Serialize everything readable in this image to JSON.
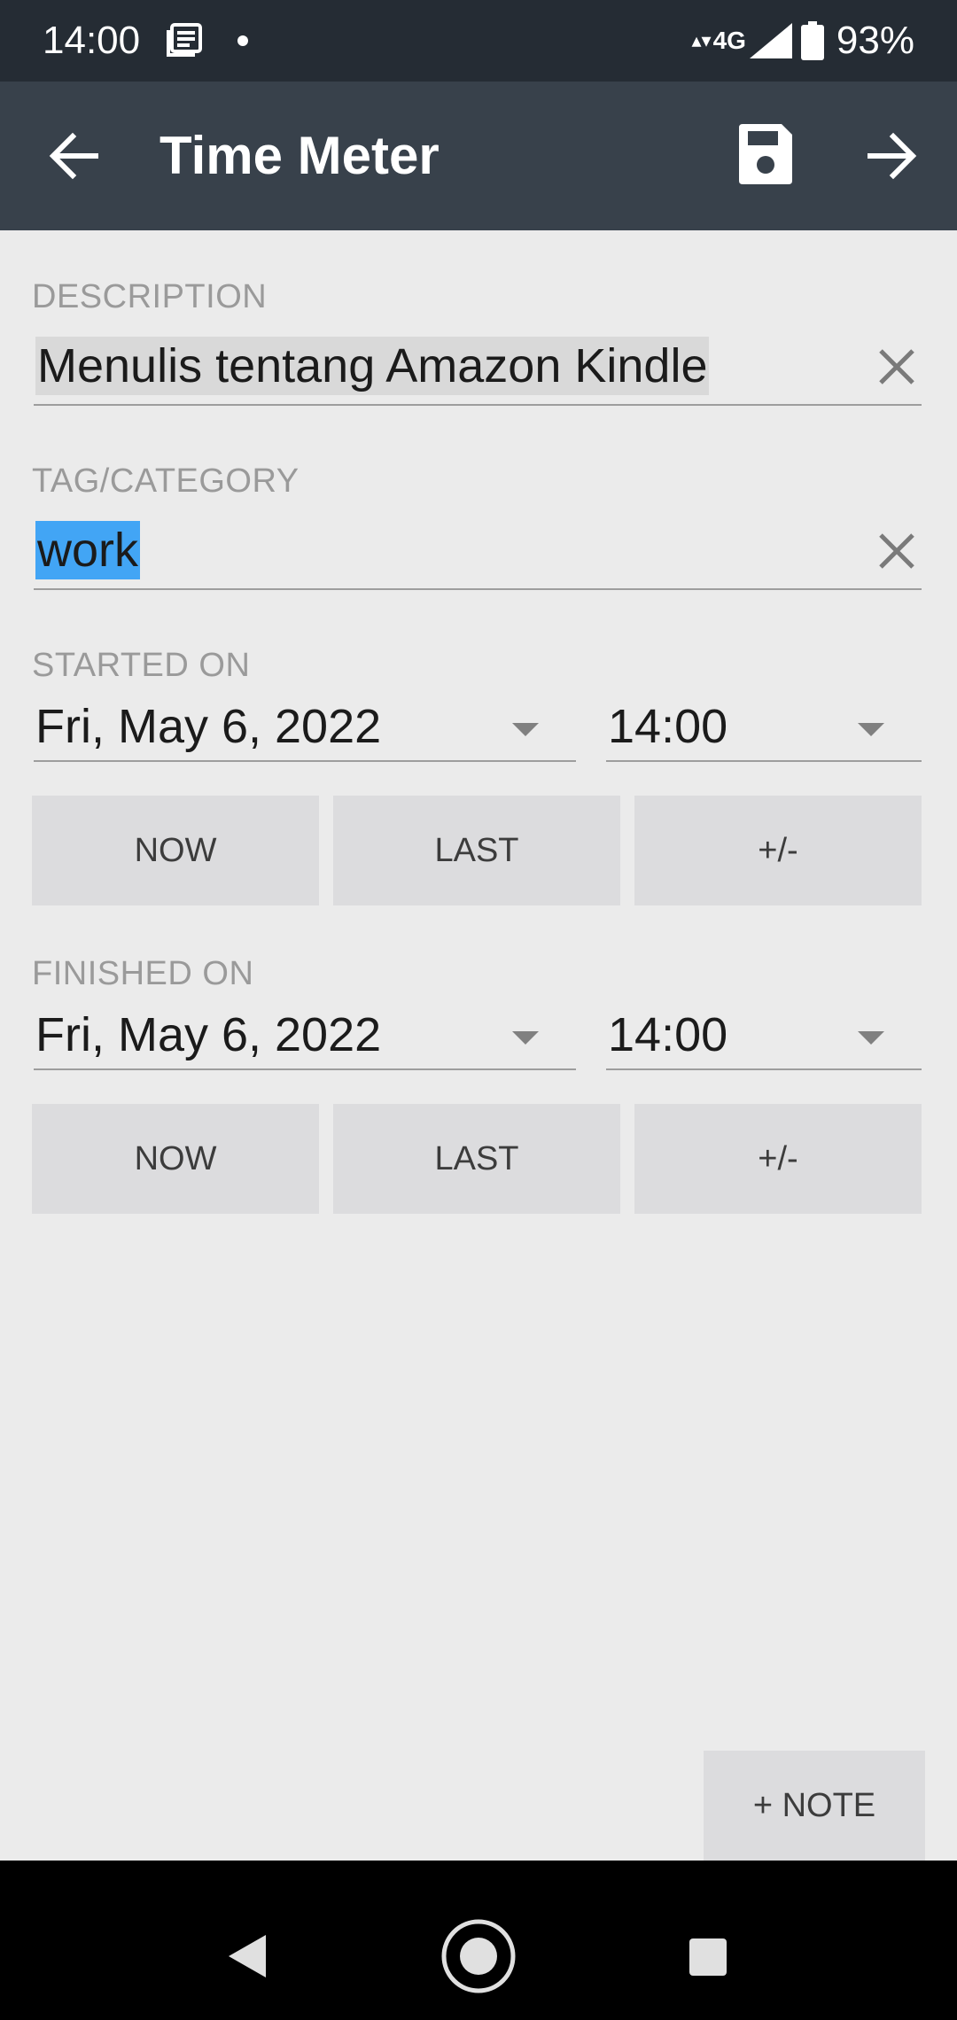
{
  "status_bar": {
    "time": "14:00",
    "network": "4G",
    "battery": "93%",
    "icons": [
      "news-icon",
      "notification-dot",
      "signal-icon",
      "battery-icon"
    ]
  },
  "app_bar": {
    "title": "Time Meter",
    "icons": [
      "back-arrow-icon",
      "save-icon",
      "forward-arrow-icon"
    ],
    "background": "#38414b"
  },
  "form": {
    "description": {
      "label": "DESCRIPTION",
      "value": "Menulis tentang Amazon Kindle"
    },
    "tag": {
      "label": "TAG/CATEGORY",
      "value": "work",
      "selection_color": "#42a5f5"
    },
    "started": {
      "label": "STARTED ON",
      "date": "Fri, May 6, 2022",
      "time": "14:00",
      "buttons": {
        "now": "NOW",
        "last": "LAST",
        "adjust": "+/-"
      }
    },
    "finished": {
      "label": "FINISHED ON",
      "date": "Fri, May 6, 2022",
      "time": "14:00",
      "buttons": {
        "now": "NOW",
        "last": "LAST",
        "adjust": "+/-"
      }
    },
    "note_button": "+ NOTE"
  },
  "nav_bar": {
    "icons": [
      "nav-back-icon",
      "nav-home-icon",
      "nav-recents-icon"
    ]
  }
}
